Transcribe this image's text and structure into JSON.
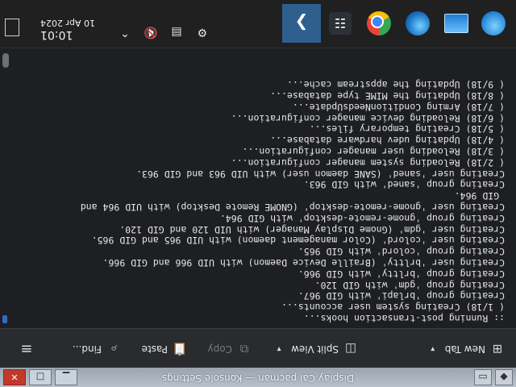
{
  "window": {
    "title": "Display Cal pacman — Konsole Settings"
  },
  "toolbar": {
    "new_tab": "New Tab",
    "split_view": "Split View",
    "copy": "Copy",
    "paste": "Paste",
    "find": "Find..."
  },
  "terminal": {
    "lines": [
      ":: Running post-transaction hooks...",
      "( 1/18) Creating system user accounts...",
      "Creating group 'brlapi' with GID 967.",
      "Creating group 'gdm' with GID 120.",
      "Creating group 'brltty' with GID 966.",
      "Creating user 'brltty' (Braille Device Daemon) with UID 966 and GID 966.",
      "Creating group 'colord' with GID 965.",
      "Creating user 'colord' (Color management daemon) with UID 965 and GID 965.",
      "Creating user 'gdm' (Gnome Display Manager) with UID 120 and GID 120.",
      "Creating group 'gnome-remote-desktop' with GID 964.",
      "Creating user 'gnome-remote-desktop' (GNOME Remote Desktop) with UID 964 and",
      " GID 964.",
      "Creating group 'saned' with GID 963.",
      "Creating user 'saned' (SANE daemon user) with UID 963 and GID 963.",
      "( 2/18) Reloading system manager configuration...",
      "( 3/18) Reloading user manager configuration...",
      "( 4/18) Updating udev hardware database...",
      "( 5/18) Creating temporary files...",
      "( 6/18) Reloading device manager configuration...",
      "( 7/18) Arming ConditionNeedsUpdate...",
      "( 8/18) Updating the MIME type database...",
      "( 9/18) Updating the appstream cache..."
    ]
  },
  "taskbar": {
    "time": "10:01",
    "date": "10 Apr 2024",
    "apps": [
      "start-icon",
      "window-icon",
      "globe-icon",
      "chrome-icon",
      "settings-icon",
      "back-icon"
    ]
  }
}
